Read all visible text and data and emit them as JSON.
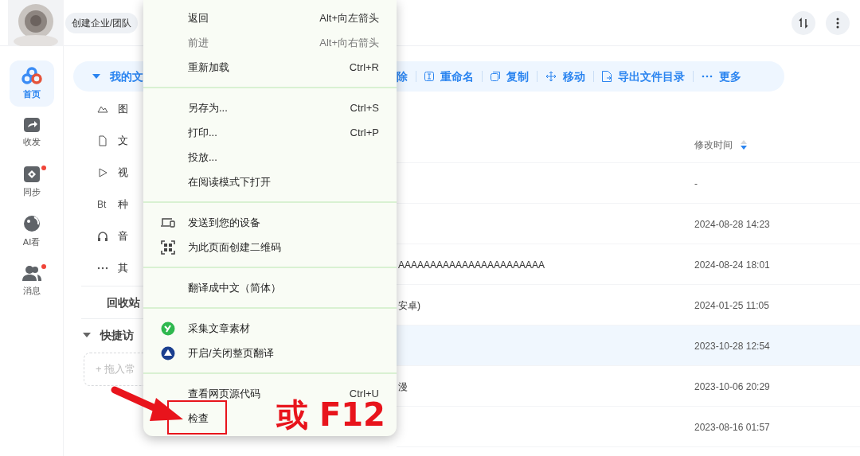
{
  "top_bar": {
    "team_button": "创建企业/团队",
    "actions": [
      {
        "kind": "sort"
      },
      {
        "kind": "more"
      }
    ]
  },
  "nav_rail": [
    {
      "label": "首页",
      "kind": "home",
      "selected": true,
      "badge": false
    },
    {
      "label": "收发",
      "kind": "share",
      "selected": false,
      "badge": false
    },
    {
      "label": "同步",
      "kind": "sync",
      "selected": false,
      "badge": true
    },
    {
      "label": "AI看",
      "kind": "ai",
      "selected": false,
      "badge": false
    },
    {
      "label": "消息",
      "kind": "message",
      "selected": false,
      "badge": true
    }
  ],
  "sidebar": {
    "my_files": {
      "label": "我的文",
      "expanded": true,
      "selected": true
    },
    "items": [
      {
        "label": "图"
      },
      {
        "label": "文",
        "kind": "doc"
      },
      {
        "label": "视",
        "kind": "video"
      },
      {
        "label": "种",
        "kind": "bt",
        "icon_text": "Bt"
      },
      {
        "label": "音",
        "kind": "audio"
      },
      {
        "label": "其",
        "kind": "other"
      }
    ],
    "recycle": "回收站",
    "quick_access": {
      "label": "快捷访",
      "expanded": true,
      "drop_hint": "+ 拖入常"
    }
  },
  "toolbar": [
    {
      "label": "除",
      "kind": "delete"
    },
    {
      "label": "重命名",
      "kind": "rename"
    },
    {
      "label": "复制",
      "kind": "copy"
    },
    {
      "label": "移动",
      "kind": "move"
    },
    {
      "label": "导出文件目录",
      "kind": "export"
    },
    {
      "label": "更多",
      "kind": "more"
    }
  ],
  "table": {
    "columns": [
      "修改时间"
    ],
    "rows": [
      {
        "time": "-",
        "selected": false
      },
      {
        "time": "2024-08-28 14:23",
        "selected": false
      },
      {
        "name": "AAAAAAAAAAAAAAAAAAAAAAA",
        "time": "2024-08-24 18:01",
        "selected": false
      },
      {
        "name": "安卓)",
        "time": "2024-01-25 11:05",
        "selected": false
      },
      {
        "time": "2023-10-28 12:54",
        "selected": true
      },
      {
        "name": "漫",
        "time": "2023-10-06 20:29",
        "selected": false
      },
      {
        "time": "2023-08-16 01:57",
        "selected": false
      }
    ]
  },
  "context_menu": [
    {
      "kind": "item",
      "label": "返回",
      "shortcut": "Alt+向左箭头",
      "disabled": false
    },
    {
      "kind": "item",
      "label": "前进",
      "shortcut": "Alt+向右箭头",
      "disabled": true
    },
    {
      "kind": "item",
      "label": "重新加载",
      "shortcut": "Ctrl+R",
      "disabled": false
    },
    {
      "kind": "divider"
    },
    {
      "kind": "item",
      "label": "另存为...",
      "shortcut": "Ctrl+S",
      "disabled": false
    },
    {
      "kind": "item",
      "label": "打印...",
      "shortcut": "Ctrl+P",
      "disabled": false
    },
    {
      "kind": "item",
      "label": "投放...",
      "disabled": false
    },
    {
      "kind": "item",
      "label": "在阅读模式下打开",
      "disabled": false
    },
    {
      "kind": "divider"
    },
    {
      "kind": "device",
      "label": "发送到您的设备",
      "disabled": false
    },
    {
      "kind": "qr",
      "label": "为此页面创建二维码",
      "disabled": false
    },
    {
      "kind": "divider"
    },
    {
      "kind": "item",
      "label": "翻译成中文（简体）",
      "disabled": false
    },
    {
      "kind": "divider"
    },
    {
      "kind": "collect",
      "label": "采集文章素材",
      "disabled": false
    },
    {
      "kind": "translate",
      "label": "开启/关闭整页翻译",
      "disabled": false
    },
    {
      "kind": "divider"
    },
    {
      "kind": "item",
      "label": "查看网页源代码",
      "shortcut": "Ctrl+U",
      "disabled": false
    },
    {
      "kind": "item",
      "label": "检查",
      "disabled": false,
      "highlighted": true
    }
  ],
  "annotation": {
    "callout": "或 F12"
  }
}
